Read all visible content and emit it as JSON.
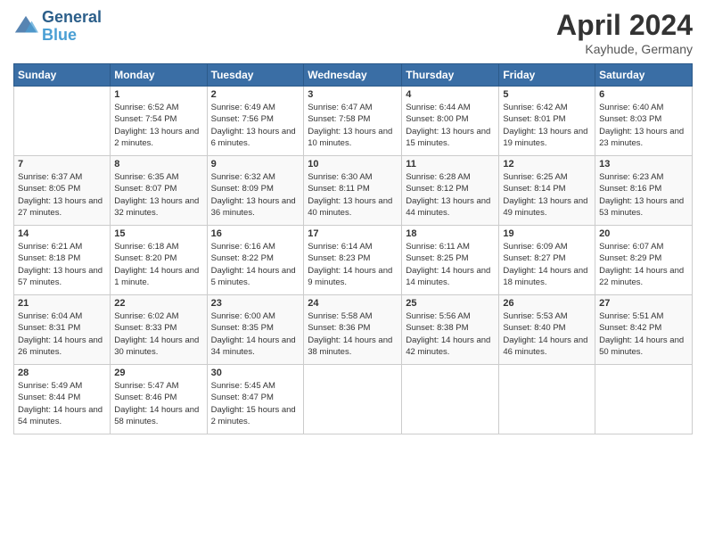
{
  "header": {
    "logo_line1": "General",
    "logo_line2": "Blue",
    "month": "April 2024",
    "location": "Kayhude, Germany"
  },
  "days_of_week": [
    "Sunday",
    "Monday",
    "Tuesday",
    "Wednesday",
    "Thursday",
    "Friday",
    "Saturday"
  ],
  "weeks": [
    [
      {
        "day": "",
        "sunrise": "",
        "sunset": "",
        "daylight": ""
      },
      {
        "day": "1",
        "sunrise": "Sunrise: 6:52 AM",
        "sunset": "Sunset: 7:54 PM",
        "daylight": "Daylight: 13 hours and 2 minutes."
      },
      {
        "day": "2",
        "sunrise": "Sunrise: 6:49 AM",
        "sunset": "Sunset: 7:56 PM",
        "daylight": "Daylight: 13 hours and 6 minutes."
      },
      {
        "day": "3",
        "sunrise": "Sunrise: 6:47 AM",
        "sunset": "Sunset: 7:58 PM",
        "daylight": "Daylight: 13 hours and 10 minutes."
      },
      {
        "day": "4",
        "sunrise": "Sunrise: 6:44 AM",
        "sunset": "Sunset: 8:00 PM",
        "daylight": "Daylight: 13 hours and 15 minutes."
      },
      {
        "day": "5",
        "sunrise": "Sunrise: 6:42 AM",
        "sunset": "Sunset: 8:01 PM",
        "daylight": "Daylight: 13 hours and 19 minutes."
      },
      {
        "day": "6",
        "sunrise": "Sunrise: 6:40 AM",
        "sunset": "Sunset: 8:03 PM",
        "daylight": "Daylight: 13 hours and 23 minutes."
      }
    ],
    [
      {
        "day": "7",
        "sunrise": "Sunrise: 6:37 AM",
        "sunset": "Sunset: 8:05 PM",
        "daylight": "Daylight: 13 hours and 27 minutes."
      },
      {
        "day": "8",
        "sunrise": "Sunrise: 6:35 AM",
        "sunset": "Sunset: 8:07 PM",
        "daylight": "Daylight: 13 hours and 32 minutes."
      },
      {
        "day": "9",
        "sunrise": "Sunrise: 6:32 AM",
        "sunset": "Sunset: 8:09 PM",
        "daylight": "Daylight: 13 hours and 36 minutes."
      },
      {
        "day": "10",
        "sunrise": "Sunrise: 6:30 AM",
        "sunset": "Sunset: 8:11 PM",
        "daylight": "Daylight: 13 hours and 40 minutes."
      },
      {
        "day": "11",
        "sunrise": "Sunrise: 6:28 AM",
        "sunset": "Sunset: 8:12 PM",
        "daylight": "Daylight: 13 hours and 44 minutes."
      },
      {
        "day": "12",
        "sunrise": "Sunrise: 6:25 AM",
        "sunset": "Sunset: 8:14 PM",
        "daylight": "Daylight: 13 hours and 49 minutes."
      },
      {
        "day": "13",
        "sunrise": "Sunrise: 6:23 AM",
        "sunset": "Sunset: 8:16 PM",
        "daylight": "Daylight: 13 hours and 53 minutes."
      }
    ],
    [
      {
        "day": "14",
        "sunrise": "Sunrise: 6:21 AM",
        "sunset": "Sunset: 8:18 PM",
        "daylight": "Daylight: 13 hours and 57 minutes."
      },
      {
        "day": "15",
        "sunrise": "Sunrise: 6:18 AM",
        "sunset": "Sunset: 8:20 PM",
        "daylight": "Daylight: 14 hours and 1 minute."
      },
      {
        "day": "16",
        "sunrise": "Sunrise: 6:16 AM",
        "sunset": "Sunset: 8:22 PM",
        "daylight": "Daylight: 14 hours and 5 minutes."
      },
      {
        "day": "17",
        "sunrise": "Sunrise: 6:14 AM",
        "sunset": "Sunset: 8:23 PM",
        "daylight": "Daylight: 14 hours and 9 minutes."
      },
      {
        "day": "18",
        "sunrise": "Sunrise: 6:11 AM",
        "sunset": "Sunset: 8:25 PM",
        "daylight": "Daylight: 14 hours and 14 minutes."
      },
      {
        "day": "19",
        "sunrise": "Sunrise: 6:09 AM",
        "sunset": "Sunset: 8:27 PM",
        "daylight": "Daylight: 14 hours and 18 minutes."
      },
      {
        "day": "20",
        "sunrise": "Sunrise: 6:07 AM",
        "sunset": "Sunset: 8:29 PM",
        "daylight": "Daylight: 14 hours and 22 minutes."
      }
    ],
    [
      {
        "day": "21",
        "sunrise": "Sunrise: 6:04 AM",
        "sunset": "Sunset: 8:31 PM",
        "daylight": "Daylight: 14 hours and 26 minutes."
      },
      {
        "day": "22",
        "sunrise": "Sunrise: 6:02 AM",
        "sunset": "Sunset: 8:33 PM",
        "daylight": "Daylight: 14 hours and 30 minutes."
      },
      {
        "day": "23",
        "sunrise": "Sunrise: 6:00 AM",
        "sunset": "Sunset: 8:35 PM",
        "daylight": "Daylight: 14 hours and 34 minutes."
      },
      {
        "day": "24",
        "sunrise": "Sunrise: 5:58 AM",
        "sunset": "Sunset: 8:36 PM",
        "daylight": "Daylight: 14 hours and 38 minutes."
      },
      {
        "day": "25",
        "sunrise": "Sunrise: 5:56 AM",
        "sunset": "Sunset: 8:38 PM",
        "daylight": "Daylight: 14 hours and 42 minutes."
      },
      {
        "day": "26",
        "sunrise": "Sunrise: 5:53 AM",
        "sunset": "Sunset: 8:40 PM",
        "daylight": "Daylight: 14 hours and 46 minutes."
      },
      {
        "day": "27",
        "sunrise": "Sunrise: 5:51 AM",
        "sunset": "Sunset: 8:42 PM",
        "daylight": "Daylight: 14 hours and 50 minutes."
      }
    ],
    [
      {
        "day": "28",
        "sunrise": "Sunrise: 5:49 AM",
        "sunset": "Sunset: 8:44 PM",
        "daylight": "Daylight: 14 hours and 54 minutes."
      },
      {
        "day": "29",
        "sunrise": "Sunrise: 5:47 AM",
        "sunset": "Sunset: 8:46 PM",
        "daylight": "Daylight: 14 hours and 58 minutes."
      },
      {
        "day": "30",
        "sunrise": "Sunrise: 5:45 AM",
        "sunset": "Sunset: 8:47 PM",
        "daylight": "Daylight: 15 hours and 2 minutes."
      },
      {
        "day": "",
        "sunrise": "",
        "sunset": "",
        "daylight": ""
      },
      {
        "day": "",
        "sunrise": "",
        "sunset": "",
        "daylight": ""
      },
      {
        "day": "",
        "sunrise": "",
        "sunset": "",
        "daylight": ""
      },
      {
        "day": "",
        "sunrise": "",
        "sunset": "",
        "daylight": ""
      }
    ]
  ]
}
